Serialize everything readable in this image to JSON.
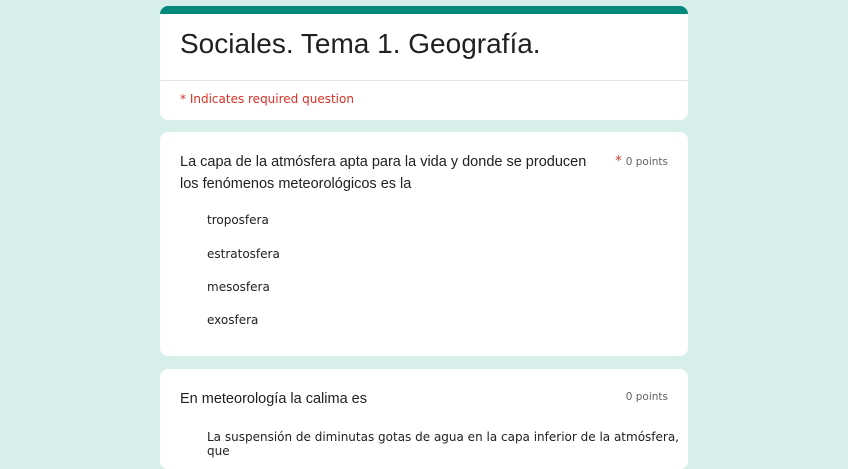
{
  "header": {
    "title": "Sociales. Tema 1. Geografía.",
    "required_note": "* Indicates required question"
  },
  "questions": [
    {
      "text": "La capa de la atmósfera apta para la vida y donde se producen los fenómenos meteorológicos es la",
      "required_mark": "*",
      "points": "0 points",
      "options": [
        "troposfera",
        "estratosfera",
        "mesosfera",
        "exosfera"
      ]
    },
    {
      "text": "En meteorología la calima es",
      "points": "0 points",
      "options": [
        "La suspensión de diminutas gotas de agua en la capa inferior de la atmósfera, que"
      ]
    }
  ],
  "colors": {
    "accent": "#00897b",
    "background": "#d7eeeb",
    "required": "#d93025"
  }
}
